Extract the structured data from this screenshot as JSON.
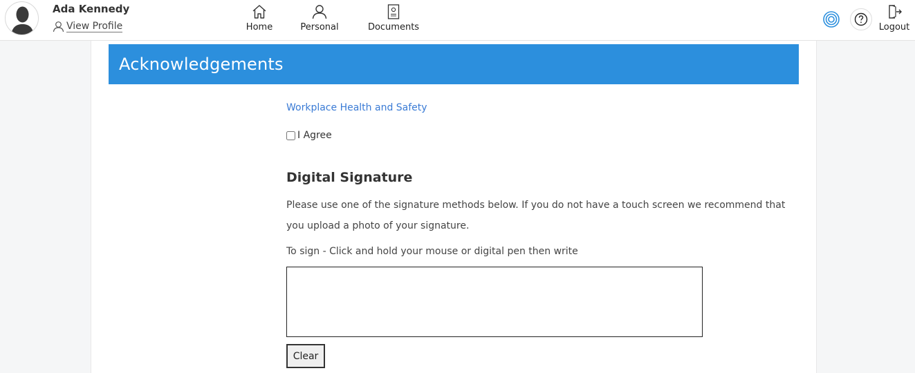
{
  "header": {
    "user_name": "Ada Kennedy",
    "view_profile_label": "View Profile",
    "nav": [
      {
        "label": "Home",
        "icon": "home-icon"
      },
      {
        "label": "Personal",
        "icon": "person-icon"
      },
      {
        "label": "Documents",
        "icon": "document-icon"
      }
    ],
    "target_icon": "target-icon",
    "help_icon": "help-icon",
    "logout_label": "Logout",
    "logout_icon": "logout-icon"
  },
  "page": {
    "title": "Acknowledgements",
    "document_link": "Workplace Health and Safety",
    "agree_label": "I Agree",
    "agree_checked": false
  },
  "signature": {
    "heading": "Digital Signature",
    "description": "Please use one of the signature methods below. If you do not have a touch screen we recommend that you upload a photo of your signature.",
    "instruction": "To sign - Click and hold your mouse or digital pen then write",
    "clear_label": "Clear"
  },
  "colors": {
    "title_bar": "#2c8fdd",
    "link": "#3a7bd5",
    "accent_icon": "#2c8fdd"
  }
}
